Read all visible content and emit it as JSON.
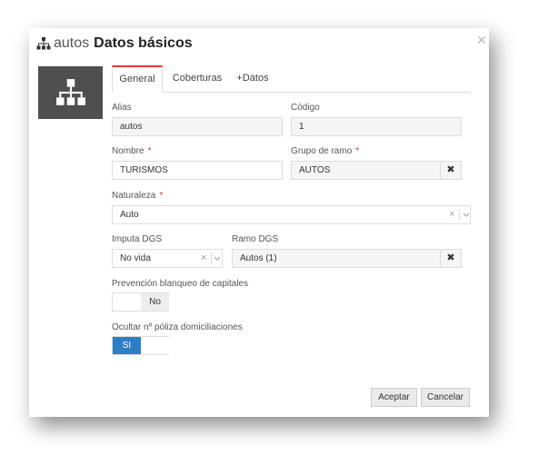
{
  "header": {
    "prefix": "autos",
    "title": "Datos básicos"
  },
  "tabs": [
    {
      "label": "General",
      "active": true
    },
    {
      "label": "Coberturas",
      "active": false
    },
    {
      "label": "+Datos",
      "active": false
    }
  ],
  "form": {
    "alias": {
      "label": "Alias",
      "value": "autos"
    },
    "codigo": {
      "label": "Código",
      "value": "1"
    },
    "nombre": {
      "label": "Nombre",
      "required": "*",
      "value": "TURISMOS"
    },
    "grupo_ramo": {
      "label": "Grupo de ramo",
      "required": "*",
      "value": "AUTOS"
    },
    "naturaleza": {
      "label": "Naturaleza",
      "required": "*",
      "value": "Auto"
    },
    "imputa_dgs": {
      "label": "Imputa DGS",
      "value": "No vida"
    },
    "ramo_dgs": {
      "label": "Ramo DGS",
      "value": "Autos (1)"
    },
    "prevencion": {
      "label": "Prevención blanqueo de capitales",
      "value": "No"
    },
    "ocultar": {
      "label": "Ocultar nº póliza domiciliaciones",
      "value": "SI"
    }
  },
  "footer": {
    "accept_label": "Aceptar",
    "cancel_label": "Cancelar"
  },
  "colors": {
    "accent_tab": "#e03b2c",
    "toggle_on": "#2e7ec4",
    "avatar_bg": "#4f4f4f"
  },
  "icons": {
    "title_icon": "sitemap-icon",
    "avatar_icon": "sitemap-icon",
    "close": "close-icon"
  }
}
